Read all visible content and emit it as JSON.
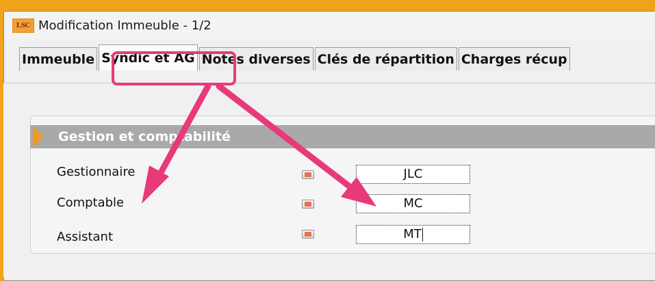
{
  "window": {
    "logo_text": "LSC",
    "title": "Modification Immeuble - 1/2"
  },
  "tabs": [
    {
      "label": "Immeuble",
      "active": false
    },
    {
      "label": "Syndic et AG",
      "active": true
    },
    {
      "label": "Notes diverses",
      "active": false
    },
    {
      "label": "Clés de répartition",
      "active": false
    },
    {
      "label": "Charges récup",
      "active": false
    }
  ],
  "section": {
    "title": "Gestion et comptabilité"
  },
  "fields": [
    {
      "label": "Gestionnaire",
      "value": "JLC"
    },
    {
      "label": "Comptable",
      "value": "MC"
    },
    {
      "label": "Assistant",
      "value": "MT"
    }
  ],
  "colors": {
    "outer_background": "#f0a318",
    "highlight": "#e8397a",
    "arrow": "#e8397a",
    "section_header": "#a9a9a9",
    "section_chevron": "#f29a1c"
  }
}
